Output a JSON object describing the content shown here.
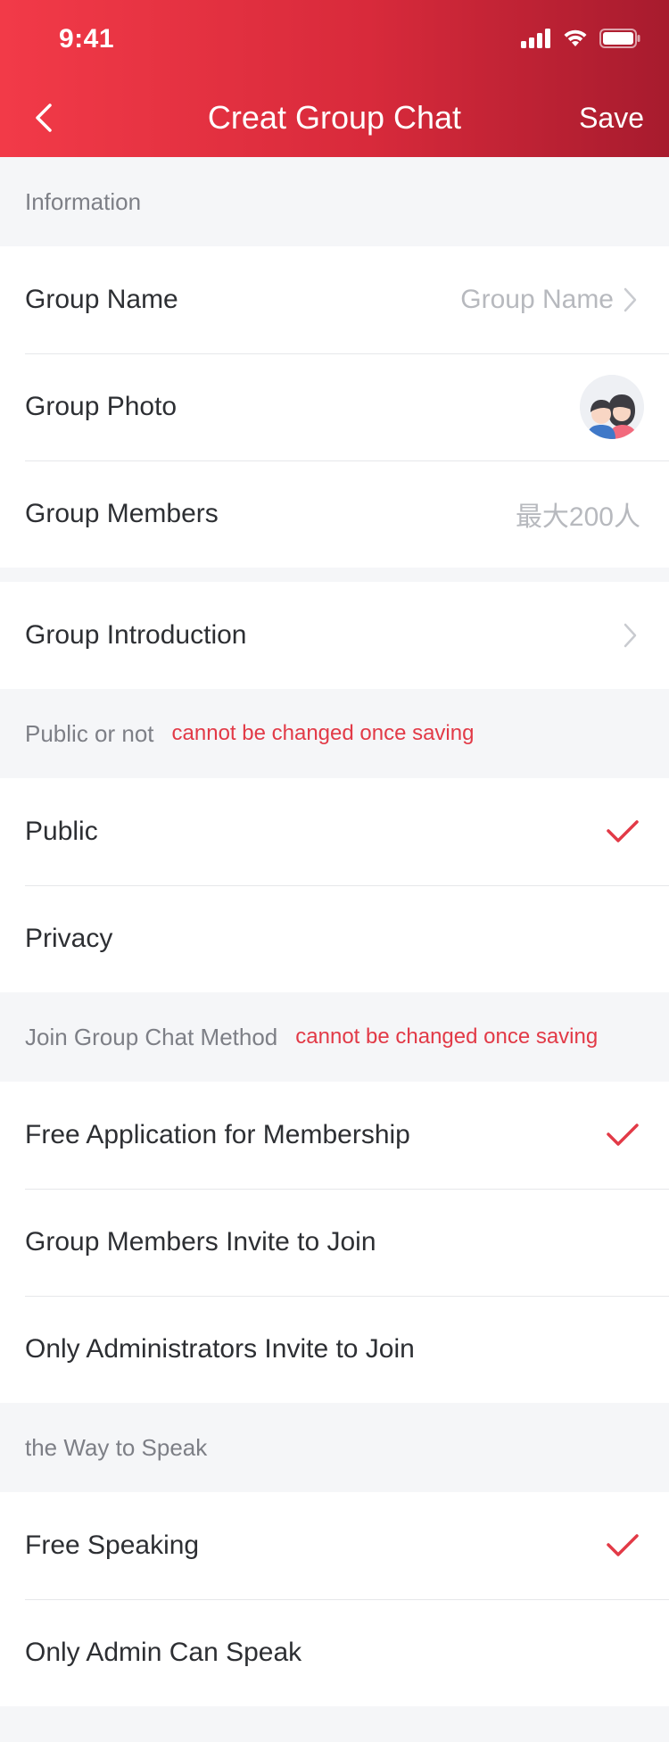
{
  "status": {
    "time": "9:41"
  },
  "header": {
    "back": "back-arrow",
    "title": "Creat Group Chat",
    "save_label": "Save"
  },
  "information": {
    "label": "Information",
    "group_name": {
      "label": "Group Name",
      "placeholder": "Group Name"
    },
    "group_photo": {
      "label": "Group Photo"
    },
    "group_members": {
      "label": "Group Members",
      "hint": "最大200人"
    }
  },
  "introduction": {
    "label": "Group Introduction"
  },
  "public_section": {
    "label": "Public or not",
    "note": "cannot be changed once saving",
    "options": [
      "Public",
      "Privacy"
    ],
    "selected": "Public"
  },
  "join_section": {
    "label": "Join Group Chat Method",
    "note": "cannot be changed once saving",
    "options": [
      "Free Application for Membership",
      "Group Members Invite to Join",
      "Only Administrators Invite to Join"
    ],
    "selected": "Free Application for Membership"
  },
  "speak_section": {
    "label": "the Way to Speak",
    "options": [
      "Free Speaking",
      "Only Admin Can Speak"
    ],
    "selected": "Free Speaking"
  },
  "colors": {
    "accent": "#e23a47",
    "header_start": "#f23a48",
    "header_end": "#a71b2e"
  },
  "icons": [
    "signal-icon",
    "wifi-icon",
    "battery-icon",
    "chevron-right-icon",
    "checkmark-icon",
    "group-avatar-icon"
  ]
}
